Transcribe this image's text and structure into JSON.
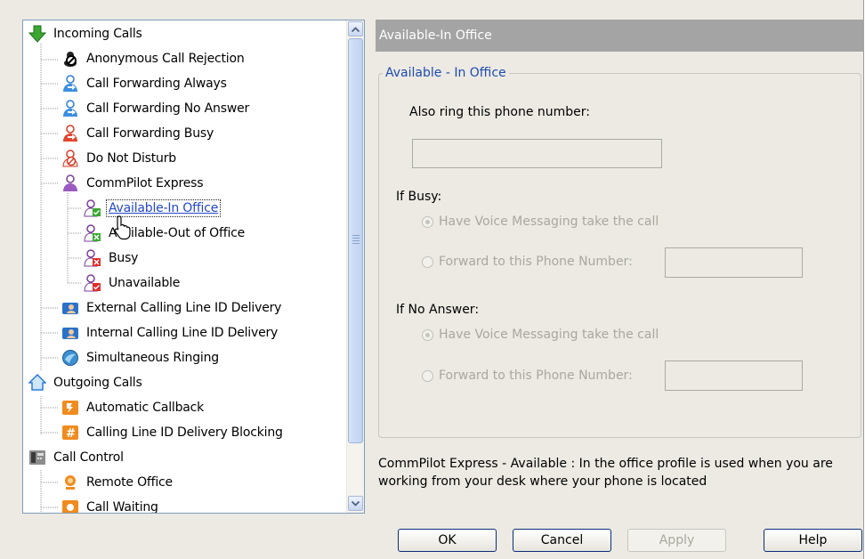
{
  "tree": {
    "items": [
      {
        "label": "Incoming Calls",
        "icon": "green-down-arrow-icon",
        "level": 0,
        "selected": false
      },
      {
        "label": "Anonymous Call Rejection",
        "icon": "anonymous-rejection-icon",
        "level": 1,
        "selected": false
      },
      {
        "label": "Call Forwarding Always",
        "icon": "call-forward-always-icon",
        "level": 1,
        "selected": false
      },
      {
        "label": "Call Forwarding No Answer",
        "icon": "call-forward-no-answer-icon",
        "level": 1,
        "selected": false
      },
      {
        "label": "Call Forwarding Busy",
        "icon": "call-forward-busy-icon",
        "level": 1,
        "selected": false
      },
      {
        "label": "Do Not Disturb",
        "icon": "do-not-disturb-icon",
        "level": 1,
        "selected": false
      },
      {
        "label": "CommPilot Express",
        "icon": "commpilot-express-icon",
        "level": 1,
        "selected": false
      },
      {
        "label": "Available-In Office",
        "icon": "available-in-office-icon",
        "level": 2,
        "selected": true
      },
      {
        "label": "Available-Out of Office",
        "icon": "available-out-of-office-icon",
        "level": 2,
        "selected": false
      },
      {
        "label": "Busy",
        "icon": "busy-profile-icon",
        "level": 2,
        "selected": false
      },
      {
        "label": "Unavailable",
        "icon": "unavailable-profile-icon",
        "level": 2,
        "selected": false
      },
      {
        "label": "External Calling Line ID Delivery",
        "icon": "external-clid-icon",
        "level": 1,
        "selected": false
      },
      {
        "label": "Internal Calling Line ID Delivery",
        "icon": "internal-clid-icon",
        "level": 1,
        "selected": false
      },
      {
        "label": "Simultaneous Ringing",
        "icon": "simultaneous-ringing-icon",
        "level": 1,
        "selected": false
      },
      {
        "label": "Outgoing Calls",
        "icon": "outgoing-house-icon",
        "level": 0,
        "selected": false
      },
      {
        "label": "Automatic Callback",
        "icon": "automatic-callback-icon",
        "level": 1,
        "selected": false
      },
      {
        "label": "Calling Line ID Delivery Blocking",
        "icon": "clid-blocking-icon",
        "level": 1,
        "selected": false
      },
      {
        "label": "Call Control",
        "icon": "phone-icon",
        "level": 0,
        "selected": false
      },
      {
        "label": "Remote Office",
        "icon": "remote-office-icon",
        "level": 1,
        "selected": false
      },
      {
        "label": "Call Waiting",
        "icon": "call-waiting-icon",
        "level": 1,
        "selected": false
      }
    ]
  },
  "panel": {
    "title": "Available-In Office",
    "group_title": "Available - In Office",
    "also_ring_label": "Also ring this phone number:",
    "also_ring_value": "",
    "if_busy_label": "If Busy:",
    "busy_voicemail_label": "Have Voice Messaging take the call",
    "busy_forward_label": "Forward to this Phone Number:",
    "busy_forward_value": "",
    "if_no_answer_label": "If No Answer:",
    "na_voicemail_label": "Have Voice Messaging take the call",
    "na_forward_label": "Forward to this Phone Number:",
    "na_forward_value": "",
    "description": "CommPilot Express - Available : In the office profile is used when you are working from your desk where your phone is located"
  },
  "buttons": {
    "ok": "OK",
    "cancel": "Cancel",
    "apply": "Apply",
    "help": "Help"
  },
  "colors": {
    "selected_text": "#2347c8",
    "title_bar": "#a4a4a4",
    "group_legend": "#1f4bb0",
    "disabled_text": "#a8a89e"
  }
}
